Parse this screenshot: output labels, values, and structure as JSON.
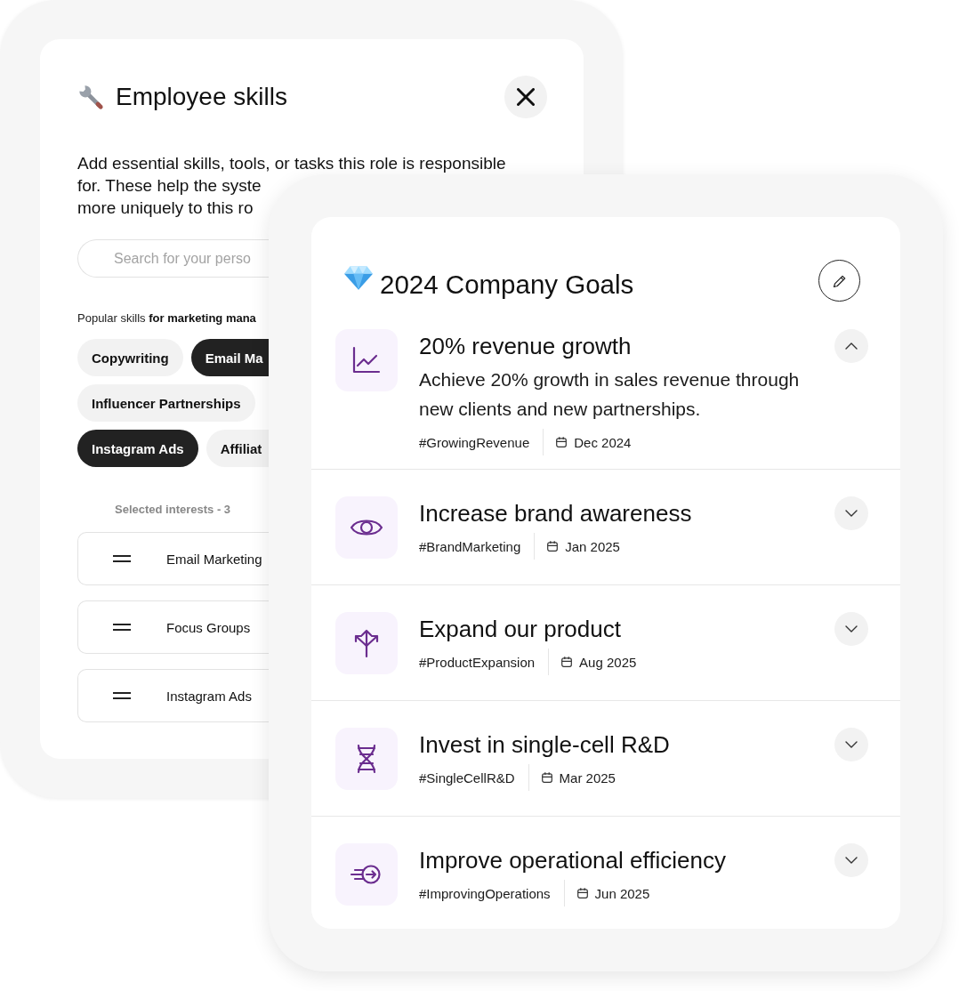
{
  "skills_card": {
    "title": "Employee skills",
    "description_lines": [
      "Add essential skills, tools, or tasks this role is responsible",
      "for. These help the syste",
      "more uniquely to this ro"
    ],
    "search": {
      "placeholder": "Search for your perso"
    },
    "popular_caption": "Popular skills **for marketing mana**",
    "skill_rows": [
      [
        {
          "label": "Copywriting",
          "selected": false
        },
        {
          "label": "Email Ma",
          "selected": true
        }
      ],
      [
        {
          "label": "Influencer Partnerships",
          "selected": false
        }
      ],
      [
        {
          "label": "Instagram Ads",
          "selected": true
        },
        {
          "label": "Affiliat",
          "selected": false
        }
      ]
    ],
    "selected_caption": "Selected interests - 3",
    "selected_items": [
      {
        "label": "Email Marketing"
      },
      {
        "label": "Focus Groups"
      },
      {
        "label": "Instagram Ads"
      }
    ]
  },
  "goals_card": {
    "title": "2024 Company Goals",
    "goals": [
      {
        "kind": "growth",
        "title": "20% revenue growth",
        "description": "Achieve 20% growth in sales revenue through new clients and new partnerships.",
        "tag": "#GrowingRevenue",
        "date": "Dec 2024",
        "expanded": true
      },
      {
        "kind": "awareness",
        "title": "Increase brand awareness",
        "tag": "#BrandMarketing",
        "date": "Jan 2025",
        "expanded": false
      },
      {
        "kind": "expansion",
        "title": "Expand our product",
        "tag": "#ProductExpansion",
        "date": "Aug 2025",
        "expanded": false
      },
      {
        "kind": "research",
        "title": "Invest in single-cell R&D",
        "tag": "#SingleCellR&D",
        "date": "Mar 2025",
        "expanded": false
      },
      {
        "kind": "efficiency",
        "title": "Improve operational efficiency",
        "tag": "#ImprovingOperations",
        "date": "Jun 2025",
        "expanded": false
      }
    ]
  }
}
